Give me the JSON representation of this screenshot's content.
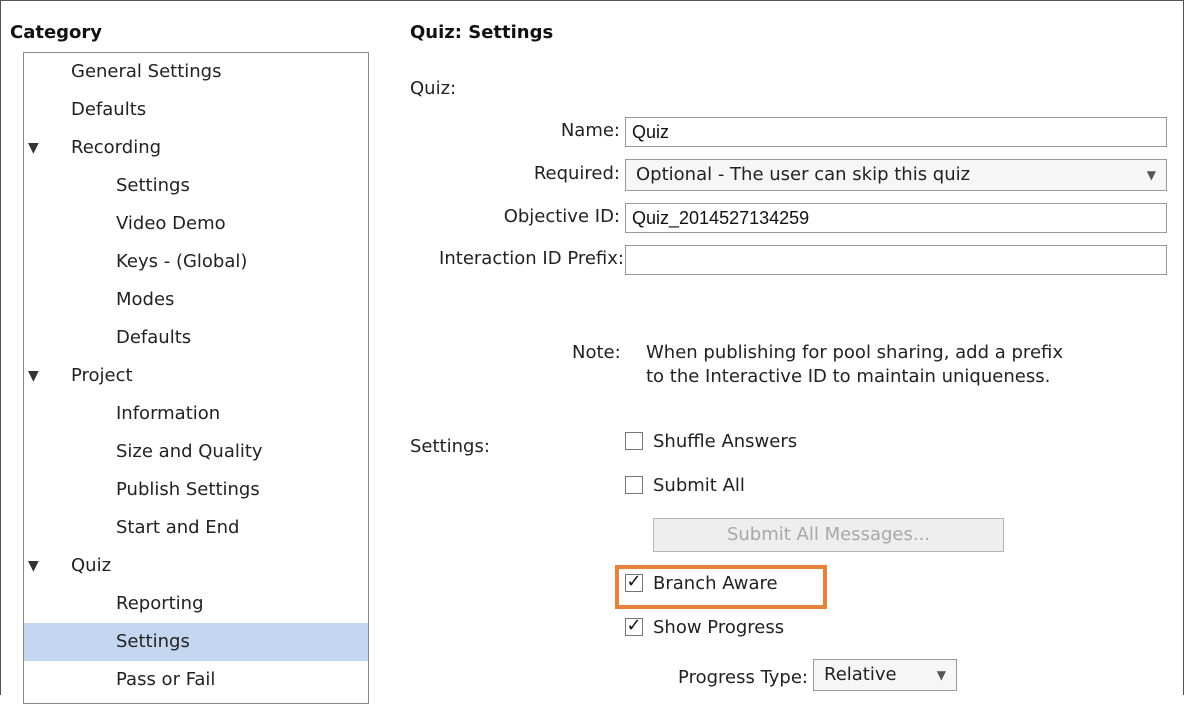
{
  "category": {
    "header": "Category",
    "items": [
      {
        "label": "General Settings"
      },
      {
        "label": "Defaults"
      },
      {
        "label": "Recording",
        "arrow": "▼"
      },
      {
        "label": "Settings"
      },
      {
        "label": "Video Demo"
      },
      {
        "label": "Keys - (Global)"
      },
      {
        "label": "Modes"
      },
      {
        "label": "Defaults"
      },
      {
        "label": "Project",
        "arrow": "▼"
      },
      {
        "label": "Information"
      },
      {
        "label": "Size and Quality"
      },
      {
        "label": "Publish Settings"
      },
      {
        "label": "Start and End"
      },
      {
        "label": "Quiz",
        "arrow": "▼"
      },
      {
        "label": "Reporting"
      },
      {
        "label": "Settings",
        "selected": true
      },
      {
        "label": "Pass or Fail"
      }
    ]
  },
  "main": {
    "header": "Quiz: Settings",
    "quiz_label": "Quiz:",
    "name_label": "Name:",
    "name_value": "Quiz",
    "required_label": "Required:",
    "required_value": "Optional - The user can skip this quiz",
    "objective_label": "Objective ID:",
    "objective_value": "Quiz_2014527134259",
    "interaction_label": "Interaction ID Prefix:",
    "interaction_value": "",
    "note_label": "Note:",
    "note_line1": "When publishing for pool sharing, add a prefix",
    "note_line2": "to the Interactive ID to maintain uniqueness.",
    "settings_label": "Settings:",
    "shuffle_label": "Shuffle Answers",
    "submit_all_label": "Submit All",
    "submit_messages_label": "Submit All Messages...",
    "branch_aware_label": "Branch Aware",
    "show_progress_label": "Show Progress",
    "progress_type_label": "Progress Type:",
    "progress_type_value": "Relative",
    "checkmark": "✓"
  },
  "colors": {
    "selection": "#c5d7f0",
    "highlight": "#e8823a"
  }
}
